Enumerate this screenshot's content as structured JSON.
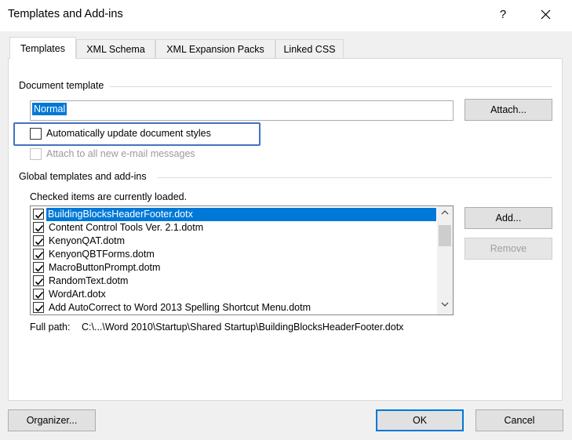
{
  "window": {
    "title": "Templates and Add-ins",
    "help_label": "?"
  },
  "tabs": [
    {
      "label": "Templates",
      "active": true
    },
    {
      "label": "XML Schema",
      "active": false
    },
    {
      "label": "XML Expansion Packs",
      "active": false
    },
    {
      "label": "Linked CSS",
      "active": false
    }
  ],
  "document_template": {
    "group_label": "Document template",
    "value": "Normal",
    "attach_label": "Attach...",
    "auto_update_label": "Automatically update document styles",
    "auto_update_checked": false,
    "attach_email_label": "Attach to all new e-mail messages",
    "attach_email_checked": false
  },
  "global": {
    "group_label": "Global templates and add-ins",
    "hint": "Checked items are currently loaded.",
    "items": [
      {
        "label": "BuildingBlocksHeaderFooter.dotx",
        "checked": true,
        "selected": true
      },
      {
        "label": "Content Control Tools Ver. 2.1.dotm",
        "checked": true,
        "selected": false
      },
      {
        "label": "KenyonQAT.dotm",
        "checked": true,
        "selected": false
      },
      {
        "label": "KenyonQBTForms.dotm",
        "checked": true,
        "selected": false
      },
      {
        "label": "MacroButtonPrompt.dotm",
        "checked": true,
        "selected": false
      },
      {
        "label": "RandomText.dotm",
        "checked": true,
        "selected": false
      },
      {
        "label": "WordArt.dotx",
        "checked": true,
        "selected": false
      },
      {
        "label": "Add AutoCorrect to Word 2013 Spelling Shortcut Menu.dotm",
        "checked": true,
        "selected": false
      }
    ],
    "add_label": "Add...",
    "remove_label": "Remove",
    "full_path_label": "Full path:",
    "full_path_value": "C:\\...\\Word 2010\\Startup\\Shared Startup\\BuildingBlocksHeaderFooter.dotx"
  },
  "footer": {
    "organizer_label": "Organizer...",
    "ok_label": "OK",
    "cancel_label": "Cancel"
  },
  "colors": {
    "accent": "#0078d7",
    "highlight_box": "#4472c4"
  }
}
